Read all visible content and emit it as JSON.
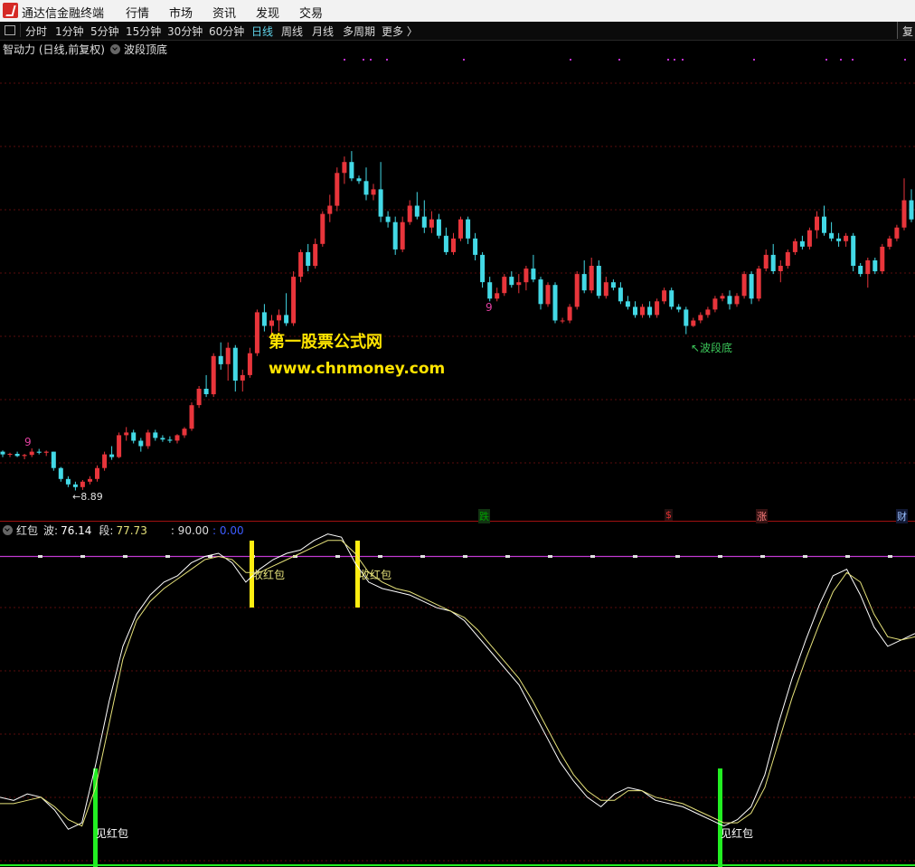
{
  "app": {
    "title": "通达信金融终端",
    "menus": [
      "行情",
      "市场",
      "资讯",
      "发现",
      "交易"
    ]
  },
  "toolbar": {
    "periods": [
      "分时",
      "1分钟",
      "5分钟",
      "15分钟",
      "30分钟",
      "60分钟",
      "日线",
      "周线",
      "月线",
      "多周期",
      "更多 〉"
    ],
    "active_period": "日线",
    "right_button": "复"
  },
  "price_panel": {
    "header": "智动力 (日线,前复权)",
    "indicator_name": "波段顶底",
    "low_label": "←8.89",
    "bottom_label": "↖波段底",
    "nine_marks": [
      "9",
      "9"
    ],
    "watermark": {
      "line1": "第一股票公式网",
      "line2": "www.chnmoney.com"
    },
    "signals": [
      {
        "text": "跌",
        "color": "#00a000",
        "bg": "#113311"
      },
      {
        "text": "$",
        "color": "#e03030",
        "bg": "#221111"
      },
      {
        "text": "涨",
        "color": "#ff8080",
        "bg": "#331111"
      },
      {
        "text": "财",
        "color": "#9ac0ff",
        "bg": "#111833"
      }
    ],
    "colors": {
      "up": "#e8353b",
      "down": "#43d9e6",
      "grid": "#5a0d0d",
      "dots": "#c02fd0"
    }
  },
  "indicator_panel": {
    "name": "红包",
    "wave_label": "波:",
    "wave_value": "76.14",
    "seg_label": "段:",
    "seg_value": "77.73",
    "level_label": ": 90.00",
    "zero_label": ": 0.00",
    "level": 90,
    "labels": {
      "sell": "收红包",
      "buy": "见红包"
    },
    "colors": {
      "wave": "#ffffff",
      "seg": "#e6e27a",
      "level_line": "#c23ad2",
      "sell_bar": "#ffee11",
      "buy_bar": "#22ee22"
    },
    "chart_data": {
      "type": "line",
      "ylim": [
        0,
        100
      ],
      "series": [
        {
          "name": "波",
          "values": [
            15,
            14,
            16,
            15,
            11,
            5,
            7,
            25,
            45,
            62,
            72,
            78,
            82,
            84,
            88,
            90,
            91,
            88,
            82,
            86,
            89,
            91,
            92,
            95,
            97,
            96,
            88,
            82,
            80,
            79,
            78,
            76,
            74,
            73,
            70,
            65,
            60,
            55,
            50,
            42,
            34,
            26,
            20,
            15,
            12,
            16,
            18,
            17,
            14,
            13,
            12,
            10,
            8,
            6,
            8,
            12,
            22,
            38,
            52,
            64,
            75,
            84,
            86,
            78,
            68,
            62,
            64,
            66
          ]
        },
        {
          "name": "段",
          "values": [
            13,
            13,
            14,
            15,
            12,
            8,
            6,
            18,
            38,
            58,
            70,
            76,
            80,
            83,
            86,
            89,
            90,
            89,
            85,
            85,
            87,
            89,
            91,
            93,
            95,
            95,
            91,
            85,
            82,
            80,
            79,
            77,
            75,
            73,
            71,
            67,
            62,
            57,
            52,
            45,
            37,
            29,
            22,
            17,
            14,
            14,
            17,
            17,
            15,
            14,
            13,
            11,
            9,
            7,
            7,
            10,
            18,
            32,
            46,
            58,
            69,
            79,
            85,
            82,
            72,
            65,
            64,
            65
          ]
        }
      ]
    }
  },
  "candles": [
    [
      9.6,
      9.62,
      9.5,
      9.55
    ],
    [
      9.55,
      9.58,
      9.5,
      9.56
    ],
    [
      9.56,
      9.6,
      9.5,
      9.52
    ],
    [
      9.52,
      9.56,
      9.46,
      9.54
    ],
    [
      9.54,
      9.66,
      9.5,
      9.6
    ],
    [
      9.6,
      9.65,
      9.55,
      9.58
    ],
    [
      9.58,
      9.62,
      9.52,
      9.6
    ],
    [
      9.6,
      9.6,
      9.25,
      9.3
    ],
    [
      9.3,
      9.32,
      9.05,
      9.1
    ],
    [
      9.1,
      9.15,
      8.95,
      9.0
    ],
    [
      9.0,
      9.05,
      8.89,
      8.95
    ],
    [
      8.95,
      9.08,
      8.9,
      9.05
    ],
    [
      9.05,
      9.15,
      9.0,
      9.1
    ],
    [
      9.1,
      9.35,
      9.05,
      9.3
    ],
    [
      9.3,
      9.6,
      9.25,
      9.55
    ],
    [
      9.55,
      9.7,
      9.45,
      9.5
    ],
    [
      9.5,
      9.95,
      9.48,
      9.9
    ],
    [
      9.9,
      10.05,
      9.8,
      9.95
    ],
    [
      9.95,
      10.0,
      9.75,
      9.8
    ],
    [
      9.8,
      9.85,
      9.6,
      9.7
    ],
    [
      9.7,
      10.0,
      9.65,
      9.95
    ],
    [
      9.95,
      10.0,
      9.8,
      9.85
    ],
    [
      9.85,
      9.9,
      9.78,
      9.82
    ],
    [
      9.82,
      9.88,
      9.76,
      9.8
    ],
    [
      9.8,
      9.92,
      9.75,
      9.9
    ],
    [
      9.9,
      10.05,
      9.85,
      10.02
    ],
    [
      10.02,
      10.5,
      9.98,
      10.45
    ],
    [
      10.45,
      10.8,
      10.4,
      10.75
    ],
    [
      10.75,
      11.0,
      10.6,
      10.65
    ],
    [
      10.65,
      11.4,
      10.6,
      11.35
    ],
    [
      11.35,
      11.6,
      11.1,
      11.2
    ],
    [
      11.2,
      11.6,
      10.9,
      11.5
    ],
    [
      11.5,
      11.55,
      10.7,
      10.9
    ],
    [
      10.9,
      11.1,
      10.7,
      11.0
    ],
    [
      11.0,
      11.5,
      10.95,
      11.4
    ],
    [
      11.4,
      12.2,
      11.35,
      12.15
    ],
    [
      12.15,
      12.3,
      11.8,
      11.9
    ],
    [
      11.9,
      12.1,
      11.7,
      12.0
    ],
    [
      12.0,
      12.2,
      11.8,
      12.1
    ],
    [
      12.1,
      12.5,
      11.9,
      11.95
    ],
    [
      11.95,
      12.9,
      11.9,
      12.8
    ],
    [
      12.8,
      13.3,
      12.7,
      13.25
    ],
    [
      13.25,
      13.4,
      12.9,
      13.0
    ],
    [
      13.0,
      13.5,
      12.95,
      13.4
    ],
    [
      13.4,
      14.0,
      13.35,
      13.95
    ],
    [
      13.95,
      14.3,
      13.8,
      14.1
    ],
    [
      14.1,
      14.8,
      14.0,
      14.7
    ],
    [
      14.7,
      15.0,
      14.5,
      14.9
    ],
    [
      14.9,
      15.1,
      14.55,
      14.6
    ],
    [
      14.6,
      14.65,
      14.5,
      14.55
    ],
    [
      14.55,
      14.8,
      14.2,
      14.3
    ],
    [
      14.3,
      14.5,
      14.2,
      14.4
    ],
    [
      14.4,
      14.9,
      13.8,
      13.9
    ],
    [
      13.9,
      14.0,
      13.7,
      13.8
    ],
    [
      13.8,
      13.9,
      13.2,
      13.3
    ],
    [
      13.3,
      13.9,
      13.25,
      13.8
    ],
    [
      13.8,
      14.2,
      13.75,
      14.1
    ],
    [
      14.1,
      14.35,
      13.85,
      13.9
    ],
    [
      13.9,
      14.2,
      13.6,
      13.7
    ],
    [
      13.7,
      14.0,
      13.6,
      13.85
    ],
    [
      13.85,
      13.95,
      13.5,
      13.55
    ],
    [
      13.55,
      13.7,
      13.2,
      13.25
    ],
    [
      13.25,
      13.6,
      13.2,
      13.5
    ],
    [
      13.5,
      13.9,
      13.45,
      13.85
    ],
    [
      13.85,
      13.9,
      13.4,
      13.5
    ],
    [
      13.5,
      13.6,
      13.1,
      13.2
    ],
    [
      13.2,
      13.25,
      12.6,
      12.7
    ],
    [
      12.7,
      12.8,
      12.35,
      12.4
    ],
    [
      12.4,
      12.6,
      12.35,
      12.5
    ],
    [
      12.5,
      12.85,
      12.45,
      12.8
    ],
    [
      12.8,
      12.9,
      12.6,
      12.65
    ],
    [
      12.65,
      12.85,
      12.5,
      12.7
    ],
    [
      12.7,
      13.0,
      12.55,
      12.95
    ],
    [
      12.95,
      13.2,
      12.7,
      12.75
    ],
    [
      12.75,
      12.8,
      12.2,
      12.3
    ],
    [
      12.3,
      12.7,
      12.25,
      12.65
    ],
    [
      12.65,
      12.7,
      11.95,
      12.0
    ],
    [
      12.0,
      12.05,
      11.95,
      12.0
    ],
    [
      12.0,
      12.3,
      11.95,
      12.25
    ],
    [
      12.25,
      12.9,
      12.2,
      12.85
    ],
    [
      12.85,
      13.1,
      12.5,
      12.55
    ],
    [
      12.55,
      13.15,
      12.5,
      13.0
    ],
    [
      13.0,
      13.1,
      12.4,
      12.45
    ],
    [
      12.45,
      12.8,
      12.4,
      12.7
    ],
    [
      12.7,
      12.75,
      12.55,
      12.6
    ],
    [
      12.6,
      12.7,
      12.3,
      12.35
    ],
    [
      12.35,
      12.45,
      12.2,
      12.25
    ],
    [
      12.25,
      12.35,
      12.05,
      12.1
    ],
    [
      12.1,
      12.3,
      12.05,
      12.25
    ],
    [
      12.25,
      12.35,
      12.05,
      12.1
    ],
    [
      12.1,
      12.4,
      12.05,
      12.35
    ],
    [
      12.35,
      12.6,
      12.3,
      12.55
    ],
    [
      12.55,
      12.6,
      12.2,
      12.25
    ],
    [
      12.25,
      12.3,
      12.15,
      12.2
    ],
    [
      12.2,
      12.25,
      11.75,
      11.9
    ],
    [
      11.9,
      12.05,
      11.88,
      12.0
    ],
    [
      12.0,
      12.15,
      11.95,
      12.1
    ],
    [
      12.1,
      12.25,
      12.05,
      12.2
    ],
    [
      12.2,
      12.45,
      12.15,
      12.4
    ],
    [
      12.4,
      12.5,
      12.35,
      12.45
    ],
    [
      12.45,
      12.55,
      12.2,
      12.3
    ],
    [
      12.3,
      12.5,
      12.25,
      12.45
    ],
    [
      12.45,
      12.9,
      12.4,
      12.85
    ],
    [
      12.85,
      12.9,
      12.3,
      12.4
    ],
    [
      12.4,
      13.0,
      12.35,
      12.95
    ],
    [
      12.95,
      13.3,
      12.9,
      13.2
    ],
    [
      13.2,
      13.4,
      12.85,
      12.9
    ],
    [
      12.9,
      13.1,
      12.7,
      13.0
    ],
    [
      13.0,
      13.3,
      12.95,
      13.25
    ],
    [
      13.25,
      13.5,
      13.2,
      13.45
    ],
    [
      13.45,
      13.55,
      13.3,
      13.35
    ],
    [
      13.35,
      13.7,
      13.3,
      13.65
    ],
    [
      13.65,
      14.0,
      13.5,
      13.9
    ],
    [
      13.9,
      14.1,
      13.55,
      13.6
    ],
    [
      13.6,
      13.8,
      13.45,
      13.5
    ],
    [
      13.5,
      13.6,
      13.35,
      13.45
    ],
    [
      13.45,
      13.6,
      13.35,
      13.55
    ],
    [
      13.55,
      13.6,
      12.9,
      13.0
    ],
    [
      13.0,
      13.05,
      12.8,
      12.85
    ],
    [
      12.85,
      13.15,
      12.6,
      13.1
    ],
    [
      13.1,
      13.15,
      12.85,
      12.9
    ],
    [
      12.9,
      13.4,
      12.85,
      13.35
    ],
    [
      13.35,
      13.55,
      13.3,
      13.5
    ],
    [
      13.5,
      13.75,
      13.45,
      13.7
    ],
    [
      13.7,
      14.6,
      13.65,
      14.2
    ],
    [
      14.2,
      14.4,
      13.8,
      13.85
    ]
  ],
  "ma_dots_count": 14
}
